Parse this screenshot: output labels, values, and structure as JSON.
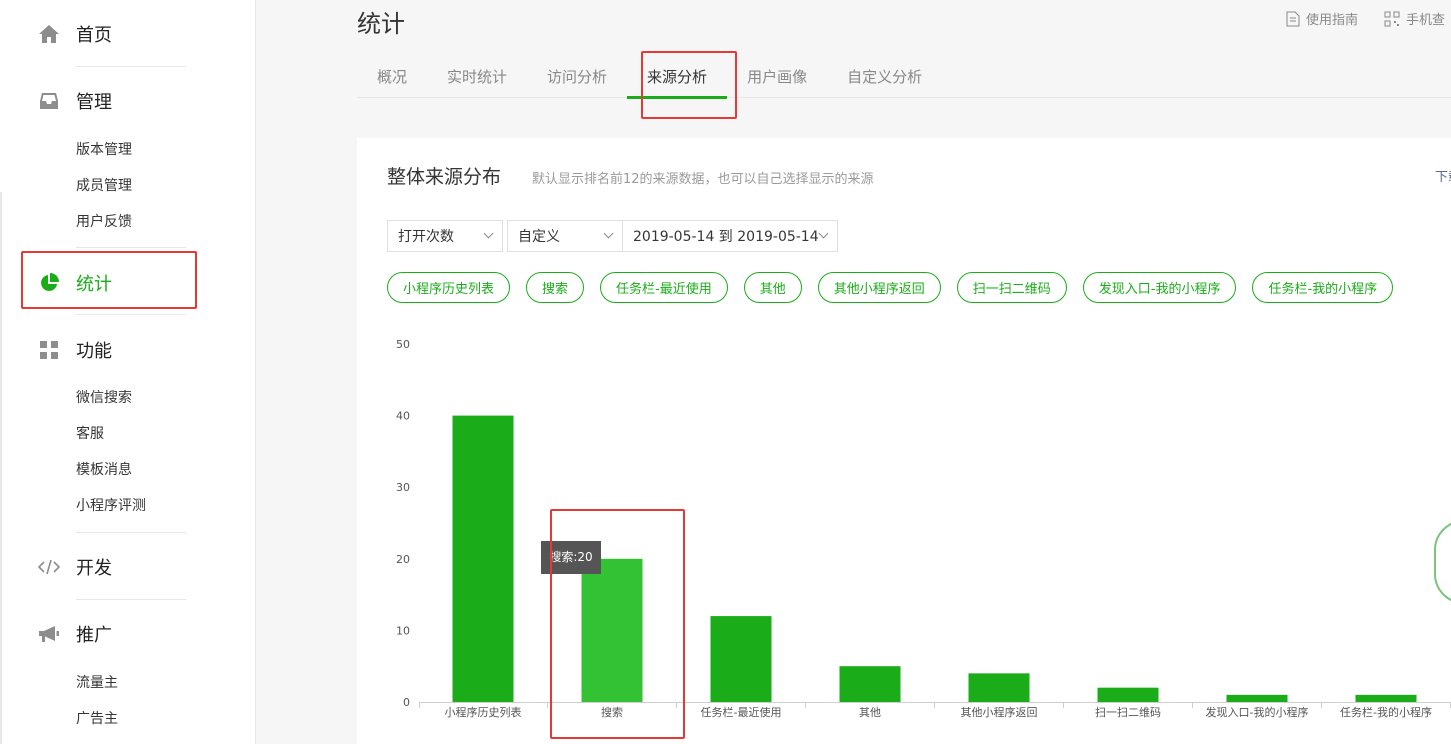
{
  "sidebar": {
    "home": {
      "label": "首页",
      "icon": "home-icon"
    },
    "manage": {
      "label": "管理",
      "icon": "inbox-icon",
      "items": [
        "版本管理",
        "成员管理",
        "用户反馈"
      ]
    },
    "stats": {
      "label": "统计",
      "icon": "pie-chart-icon"
    },
    "features": {
      "label": "功能",
      "icon": "grid-icon",
      "items": [
        "微信搜索",
        "客服",
        "模板消息",
        "小程序评测"
      ]
    },
    "develop": {
      "label": "开发",
      "icon": "code-icon"
    },
    "promote": {
      "label": "推广",
      "icon": "megaphone-icon",
      "items": [
        "流量主",
        "广告主"
      ]
    }
  },
  "header": {
    "title": "统计",
    "guide_link": "使用指南",
    "mobile_link": "手机查"
  },
  "tabs": [
    "概况",
    "实时统计",
    "访问分析",
    "来源分析",
    "用户画像",
    "自定义分析"
  ],
  "active_tab": "来源分析",
  "card": {
    "title": "整体来源分布",
    "hint": "默认显示排名前12的来源数据，也可以自己选择显示的来源",
    "link": "下载"
  },
  "filters": {
    "metric": "打开次数",
    "range_type": "自定义",
    "date_range": "2019-05-14 到 2019-05-14"
  },
  "chips": [
    "小程序历史列表",
    "搜索",
    "任务栏-最近使用",
    "其他",
    "其他小程序返回",
    "扫一扫二维码",
    "发现入口-我的小程序",
    "任务栏-我的小程序"
  ],
  "tooltip": "搜索:20",
  "colors": {
    "accent": "#1aad19",
    "highlight": "#33c233",
    "annotation": "#e53935"
  },
  "chart_data": {
    "type": "bar",
    "categories": [
      "小程序历史列表",
      "搜索",
      "任务栏-最近使用",
      "其他",
      "其他小程序返回",
      "扫一扫二维码",
      "发现入口-我的小程序",
      "任务栏-我的小程序"
    ],
    "values": [
      40,
      20,
      12,
      5,
      4,
      2,
      1,
      1
    ],
    "yticks": [
      "0",
      "10",
      "20",
      "30",
      "40",
      "50"
    ],
    "ylim": [
      0,
      50
    ],
    "highlighted": "搜索"
  }
}
